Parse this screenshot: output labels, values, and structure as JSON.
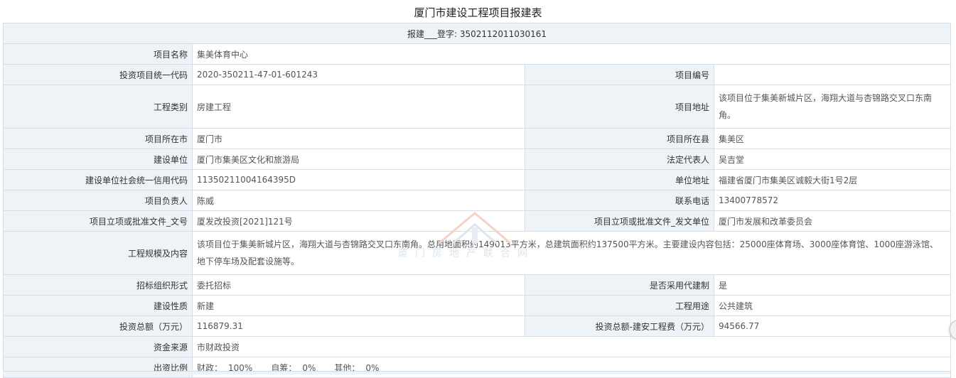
{
  "page_title": "厦门市建设工程项目报建表",
  "registration": {
    "label": "报建___登字:",
    "number": "3502112011030161"
  },
  "fields": {
    "project_name": {
      "label": "项目名称",
      "value": "集美体育中心"
    },
    "investment_code": {
      "label": "投资项目统一代码",
      "value": "2020-350211-47-01-601243"
    },
    "project_number": {
      "label": "项目编号",
      "value": ""
    },
    "engineering_category": {
      "label": "工程类别",
      "value": "房建工程"
    },
    "project_address": {
      "label": "项目地址",
      "value": "该项目位于集美新城片区，海翔大道与杏锦路交叉口东南角。"
    },
    "project_city": {
      "label": "项目所在市",
      "value": "厦门市"
    },
    "project_county": {
      "label": "项目所在县",
      "value": "集美区"
    },
    "construction_unit": {
      "label": "建设单位",
      "value": "厦门市集美区文化和旅游局"
    },
    "legal_rep": {
      "label": "法定代表人",
      "value": "吴吉堂"
    },
    "credit_code": {
      "label": "建设单位社会统一信用代码",
      "value": "11350211004164395D"
    },
    "unit_address": {
      "label": "单位地址",
      "value": "福建省厦门市集美区诚毅大街1号2层"
    },
    "project_leader": {
      "label": "项目负责人",
      "value": "陈威"
    },
    "contact_phone": {
      "label": "联系电话",
      "value": "13400778572"
    },
    "approval_doc_no": {
      "label": "项目立项或批准文件_文号",
      "value": "厦发改投资[2021]121号"
    },
    "approval_issuer": {
      "label": "项目立项或批准文件_发文单位",
      "value": "厦门市发展和改革委员会"
    },
    "scale_content": {
      "label": "工程规模及内容",
      "value": "该项目位于集美新城片区，海翔大道与杏锦路交叉口东南角。总用地面积约149013平方米，总建筑面积约137500平方米。主要建设内容包括：25000座体育场、3000座体育馆、1000座游泳馆、地下停车场及配套设施等。"
    },
    "tender_form": {
      "label": "招标组织形式",
      "value": "委托招标"
    },
    "agent_system": {
      "label": "是否采用代建制",
      "value": "是"
    },
    "construction_nature": {
      "label": "建设性质",
      "value": "新建"
    },
    "engineering_use": {
      "label": "工程用途",
      "value": "公共建筑"
    },
    "total_investment": {
      "label": "投资总额（万元）",
      "value": "116879.31"
    },
    "construction_cost": {
      "label": "投资总额-建安工程费（万元）",
      "value": "94566.77"
    },
    "fund_source": {
      "label": "资金来源",
      "value": "市财政投资"
    },
    "funding_ratio": {
      "label": "出资比例",
      "items": [
        {
          "label": "财政：",
          "value": "100%"
        },
        {
          "label": "自筹：",
          "value": "0%"
        },
        {
          "label": "其他：",
          "value": "0%"
        }
      ]
    }
  },
  "watermark": {
    "text": "厦门房地产联合网"
  },
  "colors": {
    "label_bg": "#eef3f8",
    "border": "#d6dde5",
    "text": "#333333",
    "value_text": "#555555"
  }
}
